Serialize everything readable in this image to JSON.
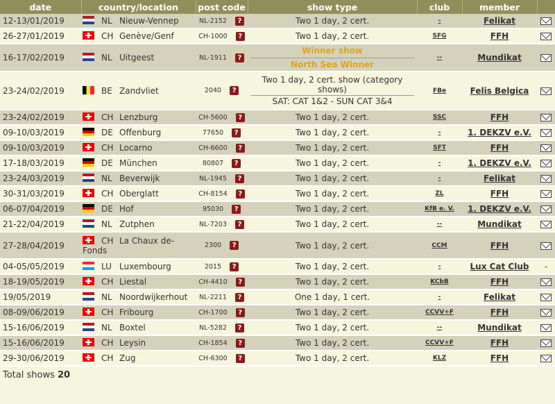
{
  "headers": {
    "date": "date",
    "country": "country/location",
    "post": "post code",
    "type": "show type",
    "club": "club",
    "member": "member"
  },
  "rows": [
    {
      "date": "12-13/01/2019",
      "flag": "nl",
      "cc": "NL",
      "city": "Nieuw-Vennep",
      "post": "NL-2152",
      "type": "Two 1 day, 2 cert.",
      "club": "-",
      "member": "Felikat"
    },
    {
      "date": "26-27/01/2019",
      "flag": "ch",
      "cc": "CH",
      "city": "Genève/Genf",
      "post": "CH-1000",
      "type": "Two 1 day, 2 cert.",
      "club": "SFG",
      "member": "FFH"
    },
    {
      "date": "16-17/02/2019",
      "flag": "nl",
      "cc": "NL",
      "city": "Uitgeest",
      "post": "NL-1911",
      "type_line1": "Winner show",
      "type_line2": "North Sea Winner",
      "club": "--",
      "member": "Mundikat"
    },
    {
      "date": "23-24/02/2019",
      "flag": "be",
      "cc": "BE",
      "city": "Zandvliet",
      "post": "2040",
      "type_line1": "Two 1 day, 2 cert. show (category shows)",
      "type_line2": "SAT: CAT 1&2 - SUN CAT 3&4",
      "club": "FBe",
      "member": "Felis Belgica"
    },
    {
      "date": "23-24/02/2019",
      "flag": "ch",
      "cc": "CH",
      "city": "Lenzburg",
      "post": "CH-5600",
      "type": "Two 1 day, 2 cert.",
      "club": "SSC",
      "member": "FFH"
    },
    {
      "date": "09-10/03/2019",
      "flag": "de",
      "cc": "DE",
      "city": "Offenburg",
      "post": "77650",
      "type": "Two 1 day, 2 cert.",
      "club": "-",
      "member": "1. DEKZV e.V."
    },
    {
      "date": "09-10/03/2019",
      "flag": "ch",
      "cc": "CH",
      "city": "Locarno",
      "post": "CH-6600",
      "type": "Two 1 day, 2 cert.",
      "club": "SFT",
      "member": "FFH"
    },
    {
      "date": "17-18/03/2019",
      "flag": "de",
      "cc": "DE",
      "city": "München",
      "post": "80807",
      "type": "Two 1 day, 2 cert.",
      "club": "-",
      "member": "1. DEKZV e.V."
    },
    {
      "date": "23-24/03/2019",
      "flag": "nl",
      "cc": "NL",
      "city": "Beverwijk",
      "post": "NL-1945",
      "type": "Two 1 day, 2 cert.",
      "club": "-",
      "member": "Felikat"
    },
    {
      "date": "30-31/03/2019",
      "flag": "ch",
      "cc": "CH",
      "city": "Oberglatt",
      "post": "CH-8154",
      "type": "Two 1 day, 2 cert.",
      "club": "ZL",
      "member": "FFH"
    },
    {
      "date": "06-07/04/2019",
      "flag": "de",
      "cc": "DE",
      "city": "Hof",
      "post": "95030",
      "type": "Two 1 day, 2 cert.",
      "club": "KfB e. V.",
      "member": "1. DEKZV e.V."
    },
    {
      "date": "21-22/04/2019",
      "flag": "nl",
      "cc": "NL",
      "city": "Zutphen",
      "post": "NL-7203",
      "type": "Two 1 day, 2 cert.",
      "club": "--",
      "member": "Mundikat"
    },
    {
      "date": "27-28/04/2019",
      "flag": "ch",
      "cc": "CH",
      "city": "La Chaux de-Fonds",
      "post": "2300",
      "type": "Two 1 day, 2 cert.",
      "club": "CCM",
      "member": "FFH"
    },
    {
      "date": "04-05/05/2019",
      "flag": "lu",
      "cc": "LU",
      "city": "Luxembourg",
      "post": "2015",
      "type": "Two 1 day, 2 cert.",
      "club": "-",
      "member": "Lux Cat Club",
      "mail": "-"
    },
    {
      "date": "18-19/05/2019",
      "flag": "ch",
      "cc": "CH",
      "city": "Liestal",
      "post": "CH-4410",
      "type": "Two 1 day, 2 cert.",
      "club": "KCbB",
      "member": "FFH"
    },
    {
      "date": "19/05/2019",
      "flag": "nl",
      "cc": "NL",
      "city": "Noordwijkerhout",
      "post": "NL-2211",
      "type": "One 1 day, 1 cert.",
      "club": "-",
      "member": "Felikat"
    },
    {
      "date": "08-09/06/2019",
      "flag": "ch",
      "cc": "CH",
      "city": "Fribourg",
      "post": "CH-1700",
      "type": "Two 1 day, 2 cert.",
      "club": "CCVV+F",
      "member": "FFH"
    },
    {
      "date": "15-16/06/2019",
      "flag": "nl",
      "cc": "NL",
      "city": "Boxtel",
      "post": "NL-5282",
      "type": "Two 1 day, 2 cert.",
      "club": "--",
      "member": "Mundikat"
    },
    {
      "date": "15-16/06/2019",
      "flag": "ch",
      "cc": "CH",
      "city": "Leysin",
      "post": "CH-1854",
      "type": "Two 1 day, 2 cert.",
      "club": "CCVV+F",
      "member": "FFH"
    },
    {
      "date": "29-30/06/2019",
      "flag": "ch",
      "cc": "CH",
      "city": "Zug",
      "post": "CH-6300",
      "type": "Two 1 day, 2 cert.",
      "club": "KLZ",
      "member": "FFH"
    }
  ],
  "footer": {
    "label": "Total shows",
    "count": "20"
  },
  "icons": {
    "map": "map-pin-icon",
    "mail": "envelope-icon"
  }
}
